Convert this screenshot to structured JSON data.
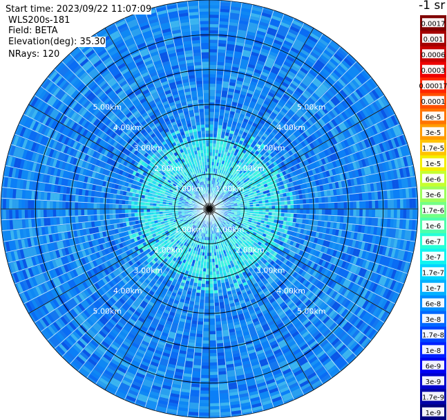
{
  "header": {
    "start_time": "Start time: 2023/09/22 11:07:09",
    "device": "WLS200s-181",
    "field": "Field: BETA",
    "elevation": "Elevation(deg): 35.30",
    "nrays": "NRays: 120"
  },
  "colorbar": {
    "unit_label": "-1 sr",
    "segments": [
      {
        "label": "0.0017",
        "color": "#800000"
      },
      {
        "label": "0.001",
        "color": "#a50000"
      },
      {
        "label": "0.0006",
        "color": "#c80000"
      },
      {
        "label": "0.0003",
        "color": "#ee0000"
      },
      {
        "label": "0.00017",
        "color": "#ff2600"
      },
      {
        "label": "0.0001",
        "color": "#ff4f00"
      },
      {
        "label": "6e-5",
        "color": "#ff7400"
      },
      {
        "label": "3e-5",
        "color": "#ff9c00"
      },
      {
        "label": "1.7e-5",
        "color": "#ffc300"
      },
      {
        "label": "1e-5",
        "color": "#f4ee00"
      },
      {
        "label": "6e-6",
        "color": "#c6ff2f"
      },
      {
        "label": "3e-6",
        "color": "#9dff5a"
      },
      {
        "label": "1.7e-6",
        "color": "#73ff84"
      },
      {
        "label": "1e-6",
        "color": "#4dffac"
      },
      {
        "label": "6e-7",
        "color": "#26ffd6"
      },
      {
        "label": "3e-7",
        "color": "#0ff4f0"
      },
      {
        "label": "1.7e-7",
        "color": "#00d4ff"
      },
      {
        "label": "1e-7",
        "color": "#00b0ff"
      },
      {
        "label": "6e-8",
        "color": "#008cff"
      },
      {
        "label": "3e-8",
        "color": "#0068ff"
      },
      {
        "label": "1.7e-8",
        "color": "#0044ff"
      },
      {
        "label": "1e-8",
        "color": "#0020ff"
      },
      {
        "label": "6e-9",
        "color": "#0000f4"
      },
      {
        "label": "3e-9",
        "color": "#0000cd"
      },
      {
        "label": "1.7e-9",
        "color": "#0000a6"
      },
      {
        "label": "1e-9",
        "color": "#00007f"
      }
    ]
  },
  "chart_data": {
    "type": "heatmap",
    "projection": "polar (PPI scan)",
    "field": "BETA",
    "unit": "sr^-1",
    "elevation_deg": 35.3,
    "n_rays": 120,
    "max_range_km": 6.0,
    "range_ring_labels": [
      "1.00km",
      "2.00km",
      "3.00km",
      "4.00km",
      "5.00km"
    ],
    "range_ring_km": [
      1,
      2,
      3,
      4,
      5
    ],
    "spoke_spacing_deg": 30,
    "color_scale": "logarithmic",
    "value_range": [
      1e-09,
      0.0017
    ],
    "regions": [
      {
        "range_km": [
          0.0,
          1.0
        ],
        "typical_value": 3e-07,
        "description": "cyan core with patchy blue"
      },
      {
        "range_km": [
          1.0,
          2.2
        ],
        "typical_value": 2e-07,
        "description": "cyan / turquoise band"
      },
      {
        "range_km": [
          2.2,
          6.0
        ],
        "typical_value": 6e-08,
        "description": "mixed blue speckle"
      }
    ]
  }
}
